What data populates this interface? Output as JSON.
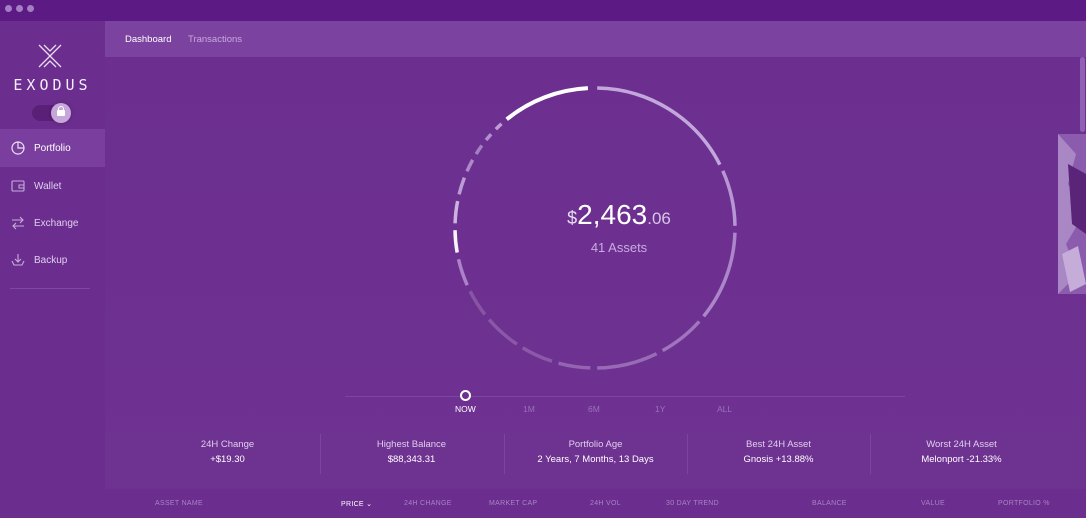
{
  "app": {
    "brand": "EXODUS"
  },
  "window_dots": [
    "close",
    "minimize",
    "maximize"
  ],
  "sidebar": {
    "items": [
      {
        "label": "Portfolio",
        "icon": "pie-chart-icon",
        "active": true
      },
      {
        "label": "Wallet",
        "icon": "wallet-icon",
        "active": false
      },
      {
        "label": "Exchange",
        "icon": "exchange-arrows-icon",
        "active": false
      },
      {
        "label": "Backup",
        "icon": "backup-tray-icon",
        "active": false
      }
    ],
    "lock_icon": "lock-icon"
  },
  "tabs": [
    {
      "label": "Dashboard",
      "active": true
    },
    {
      "label": "Transactions",
      "active": false
    }
  ],
  "portfolio": {
    "currency": "$",
    "amount_int": "2,463",
    "amount_dec": ".06",
    "assets": "41 Assets"
  },
  "timeline": {
    "options": [
      "NOW",
      "1M",
      "6M",
      "1Y",
      "ALL"
    ],
    "selected": "NOW"
  },
  "stats": [
    {
      "label": "24H Change",
      "value": "+$19.30"
    },
    {
      "label": "Highest Balance",
      "value": "$88,343.31"
    },
    {
      "label": "Portfolio Age",
      "value": "2 Years, 7 Months, 13 Days"
    },
    {
      "label": "Best 24H Asset",
      "value": "Gnosis +13.88%"
    },
    {
      "label": "Worst 24H Asset",
      "value": "Melonport -21.33%"
    }
  ],
  "table": {
    "columns": [
      {
        "label": "ASSET NAME"
      },
      {
        "label": "PRICE",
        "sorted": true
      },
      {
        "label": "24H CHANGE"
      },
      {
        "label": "MARKET CAP"
      },
      {
        "label": "24H VOL"
      },
      {
        "label": "30 DAY TREND"
      },
      {
        "label": "BALANCE"
      },
      {
        "label": "VALUE"
      },
      {
        "label": "PORTFOLIO %"
      }
    ]
  },
  "colors": {
    "background": "#6c2f8f",
    "sidebar": "#6b2e8e",
    "topbar": "#7b439f",
    "accent": "#ffffff"
  }
}
